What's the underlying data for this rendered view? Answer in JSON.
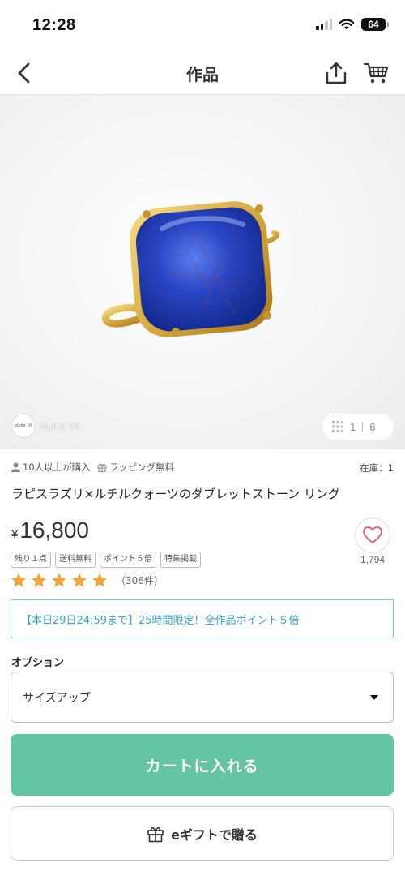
{
  "status_bar": {
    "time": "12:28",
    "battery": "64"
  },
  "nav": {
    "title": "作品"
  },
  "gallery": {
    "shop_name": "alpha Vir",
    "shop_logo_text": "alpha Vir",
    "current": "1",
    "total": "6"
  },
  "product": {
    "purchased": "10人以上が購入",
    "wrapping": "ラッピング無料",
    "stock": "在庫：1",
    "title": "ラピスラズリ×ルチルクォーツのダブレットストーン リング",
    "currency": "¥",
    "price": "16,800",
    "favorites": "1,794",
    "tags": [
      "残り１点",
      "送料無料",
      "ポイント５倍",
      "特集掲載"
    ],
    "rating": 5,
    "review_count": "（306件）"
  },
  "campaign": {
    "text": "【本日29日24:59まで】25時間限定！全作品ポイント５倍"
  },
  "option": {
    "label": "オプション",
    "selected": "サイズアップ"
  },
  "actions": {
    "cart_label": "カートに入れる",
    "gift_label": "eギフトで贈る"
  },
  "colors": {
    "accent_green": "#63c5a1",
    "campaign_blue": "#39a4c9",
    "star_orange": "#f0a63a",
    "heart_red": "#e8596b"
  }
}
